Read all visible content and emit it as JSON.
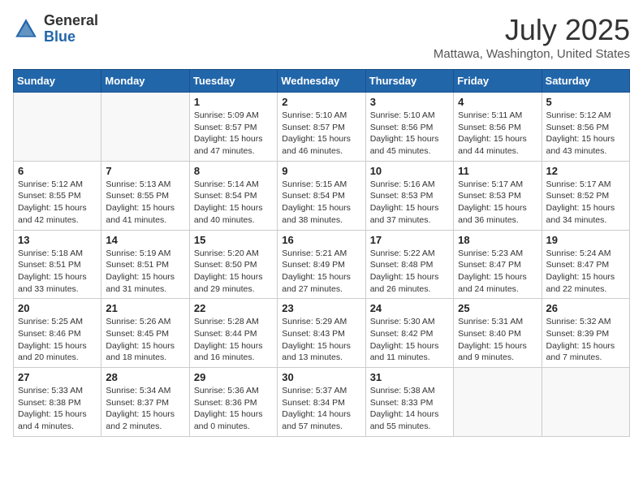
{
  "header": {
    "logo_general": "General",
    "logo_blue": "Blue",
    "month_title": "July 2025",
    "location": "Mattawa, Washington, United States"
  },
  "weekdays": [
    "Sunday",
    "Monday",
    "Tuesday",
    "Wednesday",
    "Thursday",
    "Friday",
    "Saturday"
  ],
  "weeks": [
    [
      {
        "day": "",
        "sunrise": "",
        "sunset": "",
        "daylight": ""
      },
      {
        "day": "",
        "sunrise": "",
        "sunset": "",
        "daylight": ""
      },
      {
        "day": "1",
        "sunrise": "Sunrise: 5:09 AM",
        "sunset": "Sunset: 8:57 PM",
        "daylight": "Daylight: 15 hours and 47 minutes."
      },
      {
        "day": "2",
        "sunrise": "Sunrise: 5:10 AM",
        "sunset": "Sunset: 8:57 PM",
        "daylight": "Daylight: 15 hours and 46 minutes."
      },
      {
        "day": "3",
        "sunrise": "Sunrise: 5:10 AM",
        "sunset": "Sunset: 8:56 PM",
        "daylight": "Daylight: 15 hours and 45 minutes."
      },
      {
        "day": "4",
        "sunrise": "Sunrise: 5:11 AM",
        "sunset": "Sunset: 8:56 PM",
        "daylight": "Daylight: 15 hours and 44 minutes."
      },
      {
        "day": "5",
        "sunrise": "Sunrise: 5:12 AM",
        "sunset": "Sunset: 8:56 PM",
        "daylight": "Daylight: 15 hours and 43 minutes."
      }
    ],
    [
      {
        "day": "6",
        "sunrise": "Sunrise: 5:12 AM",
        "sunset": "Sunset: 8:55 PM",
        "daylight": "Daylight: 15 hours and 42 minutes."
      },
      {
        "day": "7",
        "sunrise": "Sunrise: 5:13 AM",
        "sunset": "Sunset: 8:55 PM",
        "daylight": "Daylight: 15 hours and 41 minutes."
      },
      {
        "day": "8",
        "sunrise": "Sunrise: 5:14 AM",
        "sunset": "Sunset: 8:54 PM",
        "daylight": "Daylight: 15 hours and 40 minutes."
      },
      {
        "day": "9",
        "sunrise": "Sunrise: 5:15 AM",
        "sunset": "Sunset: 8:54 PM",
        "daylight": "Daylight: 15 hours and 38 minutes."
      },
      {
        "day": "10",
        "sunrise": "Sunrise: 5:16 AM",
        "sunset": "Sunset: 8:53 PM",
        "daylight": "Daylight: 15 hours and 37 minutes."
      },
      {
        "day": "11",
        "sunrise": "Sunrise: 5:17 AM",
        "sunset": "Sunset: 8:53 PM",
        "daylight": "Daylight: 15 hours and 36 minutes."
      },
      {
        "day": "12",
        "sunrise": "Sunrise: 5:17 AM",
        "sunset": "Sunset: 8:52 PM",
        "daylight": "Daylight: 15 hours and 34 minutes."
      }
    ],
    [
      {
        "day": "13",
        "sunrise": "Sunrise: 5:18 AM",
        "sunset": "Sunset: 8:51 PM",
        "daylight": "Daylight: 15 hours and 33 minutes."
      },
      {
        "day": "14",
        "sunrise": "Sunrise: 5:19 AM",
        "sunset": "Sunset: 8:51 PM",
        "daylight": "Daylight: 15 hours and 31 minutes."
      },
      {
        "day": "15",
        "sunrise": "Sunrise: 5:20 AM",
        "sunset": "Sunset: 8:50 PM",
        "daylight": "Daylight: 15 hours and 29 minutes."
      },
      {
        "day": "16",
        "sunrise": "Sunrise: 5:21 AM",
        "sunset": "Sunset: 8:49 PM",
        "daylight": "Daylight: 15 hours and 27 minutes."
      },
      {
        "day": "17",
        "sunrise": "Sunrise: 5:22 AM",
        "sunset": "Sunset: 8:48 PM",
        "daylight": "Daylight: 15 hours and 26 minutes."
      },
      {
        "day": "18",
        "sunrise": "Sunrise: 5:23 AM",
        "sunset": "Sunset: 8:47 PM",
        "daylight": "Daylight: 15 hours and 24 minutes."
      },
      {
        "day": "19",
        "sunrise": "Sunrise: 5:24 AM",
        "sunset": "Sunset: 8:47 PM",
        "daylight": "Daylight: 15 hours and 22 minutes."
      }
    ],
    [
      {
        "day": "20",
        "sunrise": "Sunrise: 5:25 AM",
        "sunset": "Sunset: 8:46 PM",
        "daylight": "Daylight: 15 hours and 20 minutes."
      },
      {
        "day": "21",
        "sunrise": "Sunrise: 5:26 AM",
        "sunset": "Sunset: 8:45 PM",
        "daylight": "Daylight: 15 hours and 18 minutes."
      },
      {
        "day": "22",
        "sunrise": "Sunrise: 5:28 AM",
        "sunset": "Sunset: 8:44 PM",
        "daylight": "Daylight: 15 hours and 16 minutes."
      },
      {
        "day": "23",
        "sunrise": "Sunrise: 5:29 AM",
        "sunset": "Sunset: 8:43 PM",
        "daylight": "Daylight: 15 hours and 13 minutes."
      },
      {
        "day": "24",
        "sunrise": "Sunrise: 5:30 AM",
        "sunset": "Sunset: 8:42 PM",
        "daylight": "Daylight: 15 hours and 11 minutes."
      },
      {
        "day": "25",
        "sunrise": "Sunrise: 5:31 AM",
        "sunset": "Sunset: 8:40 PM",
        "daylight": "Daylight: 15 hours and 9 minutes."
      },
      {
        "day": "26",
        "sunrise": "Sunrise: 5:32 AM",
        "sunset": "Sunset: 8:39 PM",
        "daylight": "Daylight: 15 hours and 7 minutes."
      }
    ],
    [
      {
        "day": "27",
        "sunrise": "Sunrise: 5:33 AM",
        "sunset": "Sunset: 8:38 PM",
        "daylight": "Daylight: 15 hours and 4 minutes."
      },
      {
        "day": "28",
        "sunrise": "Sunrise: 5:34 AM",
        "sunset": "Sunset: 8:37 PM",
        "daylight": "Daylight: 15 hours and 2 minutes."
      },
      {
        "day": "29",
        "sunrise": "Sunrise: 5:36 AM",
        "sunset": "Sunset: 8:36 PM",
        "daylight": "Daylight: 15 hours and 0 minutes."
      },
      {
        "day": "30",
        "sunrise": "Sunrise: 5:37 AM",
        "sunset": "Sunset: 8:34 PM",
        "daylight": "Daylight: 14 hours and 57 minutes."
      },
      {
        "day": "31",
        "sunrise": "Sunrise: 5:38 AM",
        "sunset": "Sunset: 8:33 PM",
        "daylight": "Daylight: 14 hours and 55 minutes."
      },
      {
        "day": "",
        "sunrise": "",
        "sunset": "",
        "daylight": ""
      },
      {
        "day": "",
        "sunrise": "",
        "sunset": "",
        "daylight": ""
      }
    ]
  ]
}
